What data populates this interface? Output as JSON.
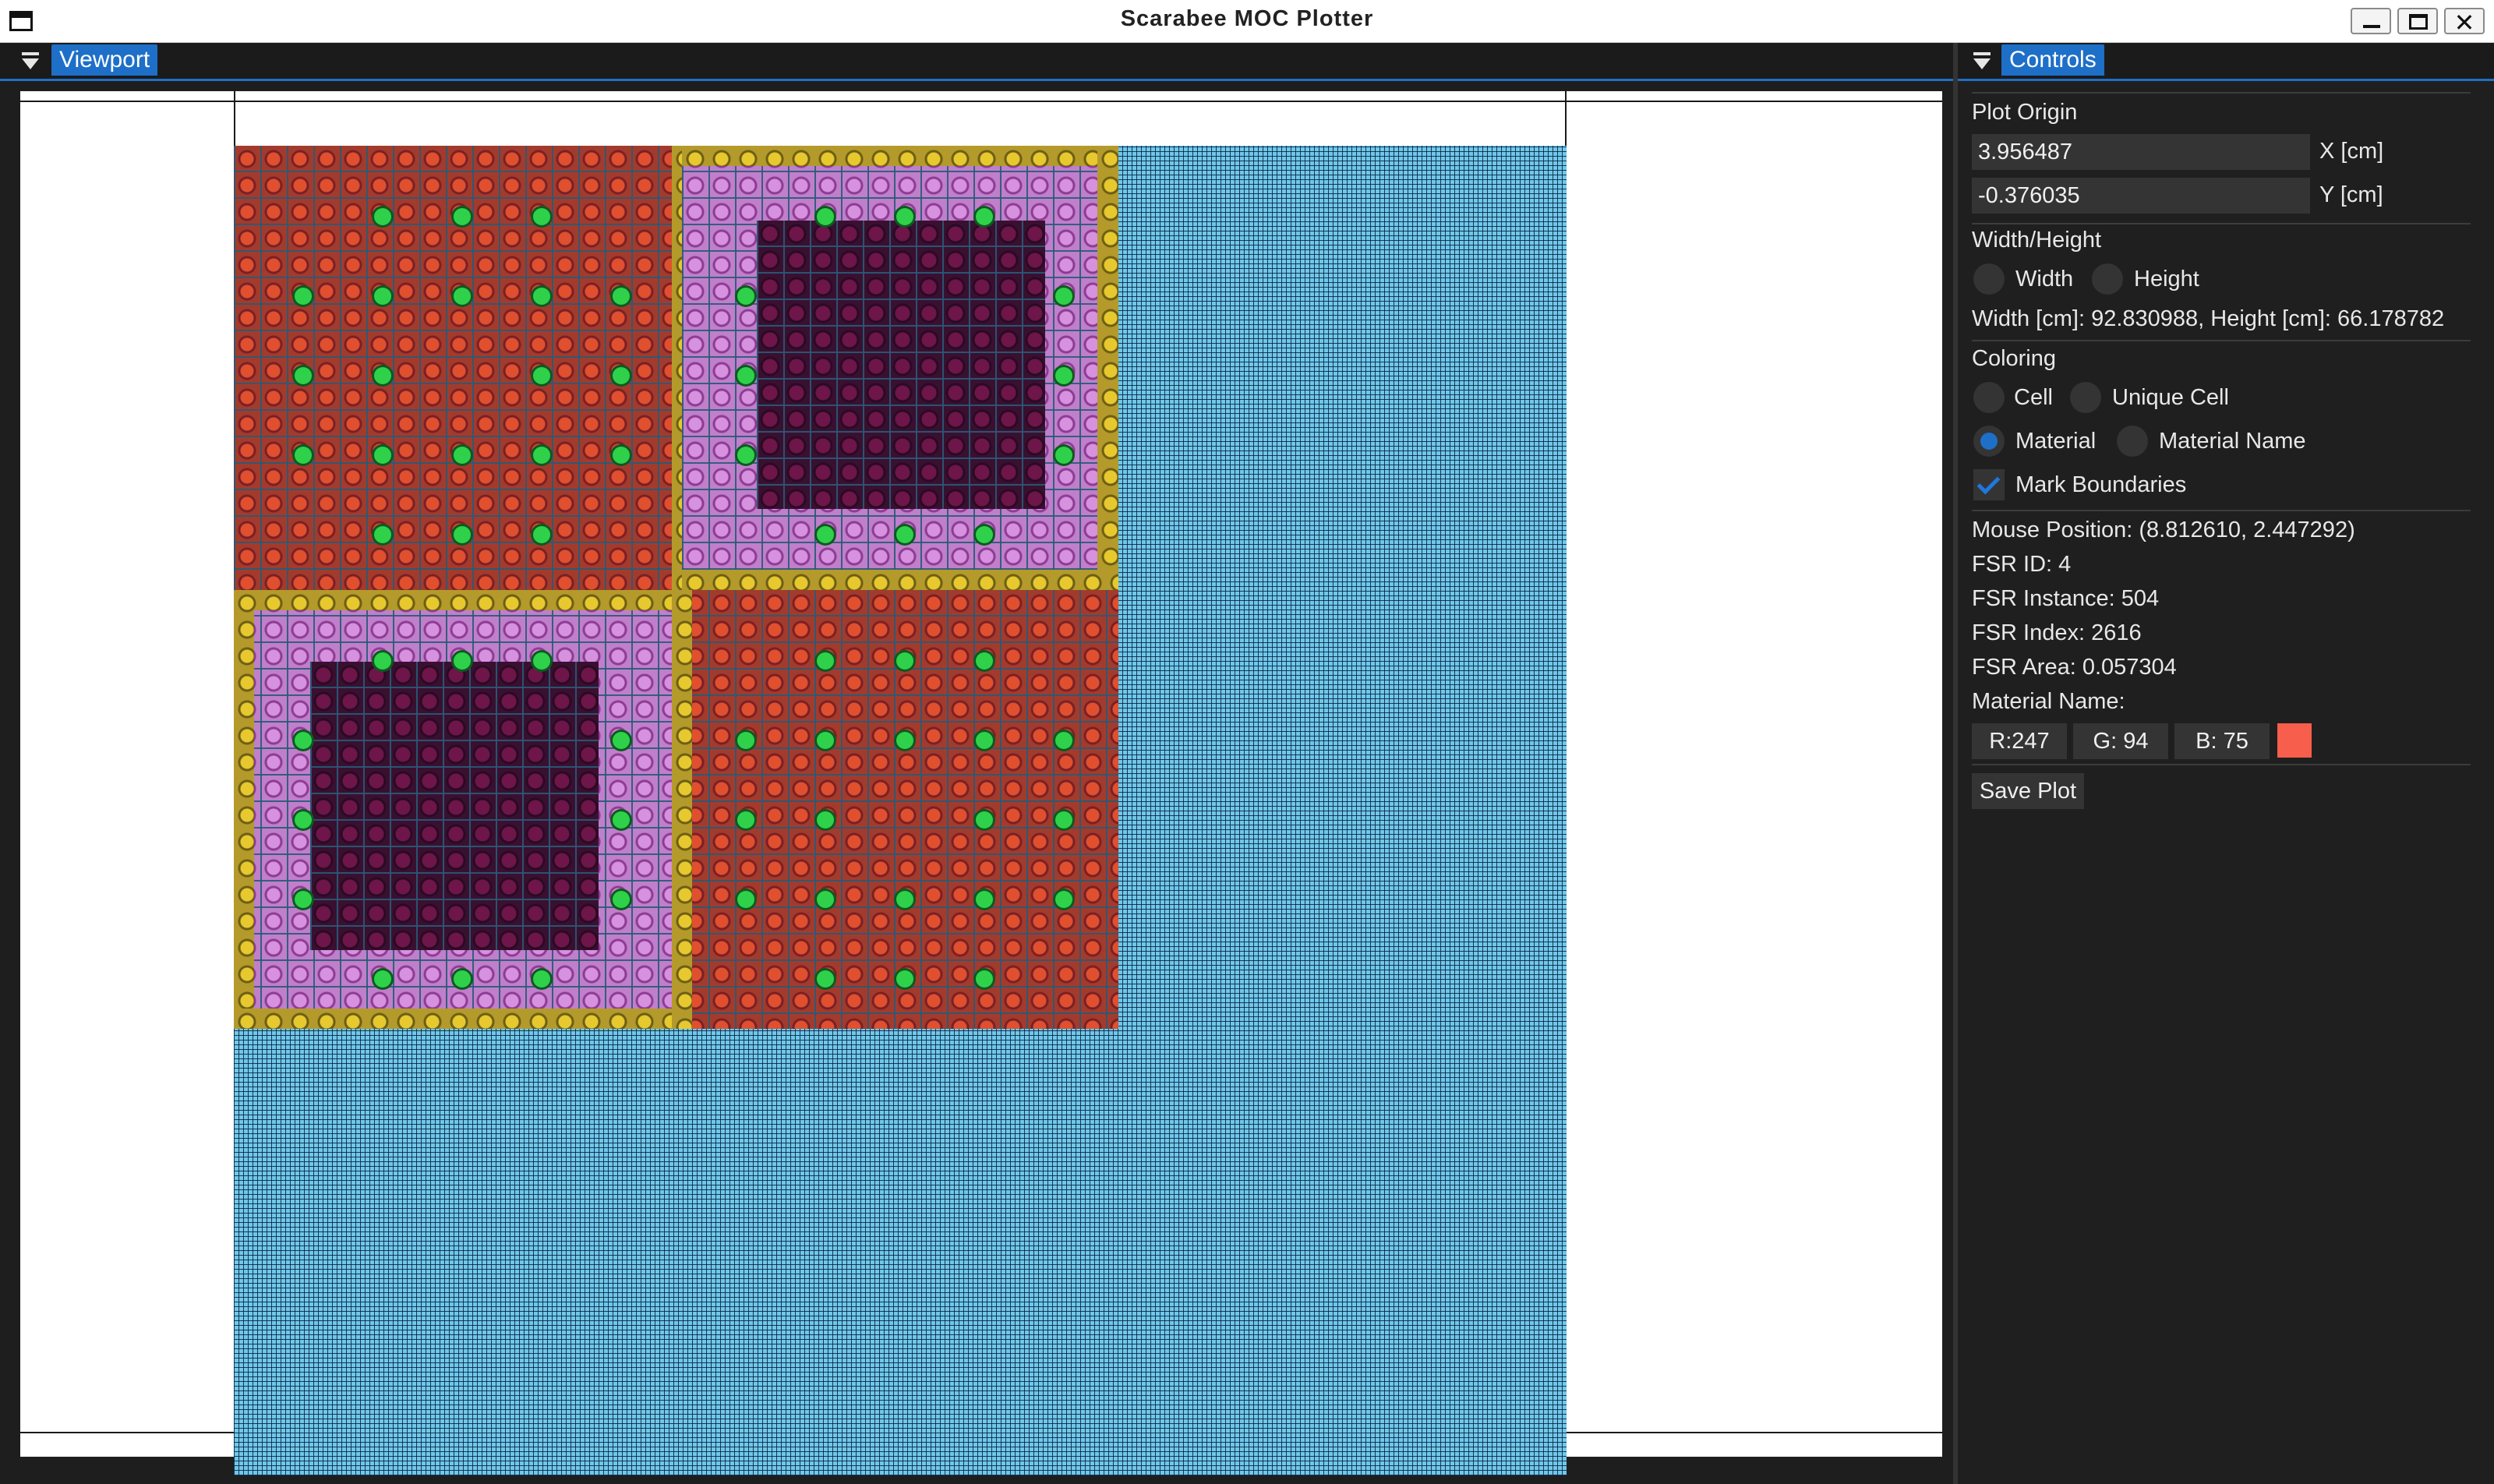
{
  "window": {
    "title": "Scarabee MOC Plotter",
    "close_glyph": "✕"
  },
  "viewport": {
    "tab_label": "Viewport"
  },
  "controls": {
    "tab_label": "Controls",
    "plot_origin": {
      "heading": "Plot Origin",
      "x_value": "3.956487",
      "x_label": "X [cm]",
      "y_value": "-0.376035",
      "y_label": "Y [cm]"
    },
    "width_height": {
      "heading": "Width/Height",
      "options": [
        {
          "label": "Width",
          "selected": false
        },
        {
          "label": "Height",
          "selected": false
        }
      ],
      "readout": "Width [cm]: 92.830988, Height [cm]: 66.178782"
    },
    "coloring": {
      "heading": "Coloring",
      "options": [
        {
          "label": "Cell",
          "selected": false
        },
        {
          "label": "Unique Cell",
          "selected": false
        },
        {
          "label": "Material",
          "selected": true
        },
        {
          "label": "Material Name",
          "selected": false
        }
      ],
      "mark_boundaries": {
        "label": "Mark Boundaries",
        "checked": true
      }
    },
    "info": {
      "mouse_position": "Mouse Position: (8.812610, 2.447292)",
      "fsr_id": "FSR ID: 4",
      "fsr_instance": "FSR Instance: 504",
      "fsr_index": "FSR Index: 2616",
      "fsr_area": "FSR Area: 0.057304",
      "material_name": "Material Name:"
    },
    "color": {
      "r": "R:247",
      "g": "G: 94",
      "b": "B: 75",
      "swatch": "#f75e4b"
    },
    "save_label": "Save Plot"
  },
  "colors": {
    "accent": "#1e6fc8",
    "moderator": "#6fc8ea",
    "uo2_fuel": "#e0502f",
    "mox_fuel": "#c07fca",
    "mox_high": "#6e1549",
    "guide_tube": "#2fd14a",
    "fission_chamber": "#e7c92f"
  }
}
